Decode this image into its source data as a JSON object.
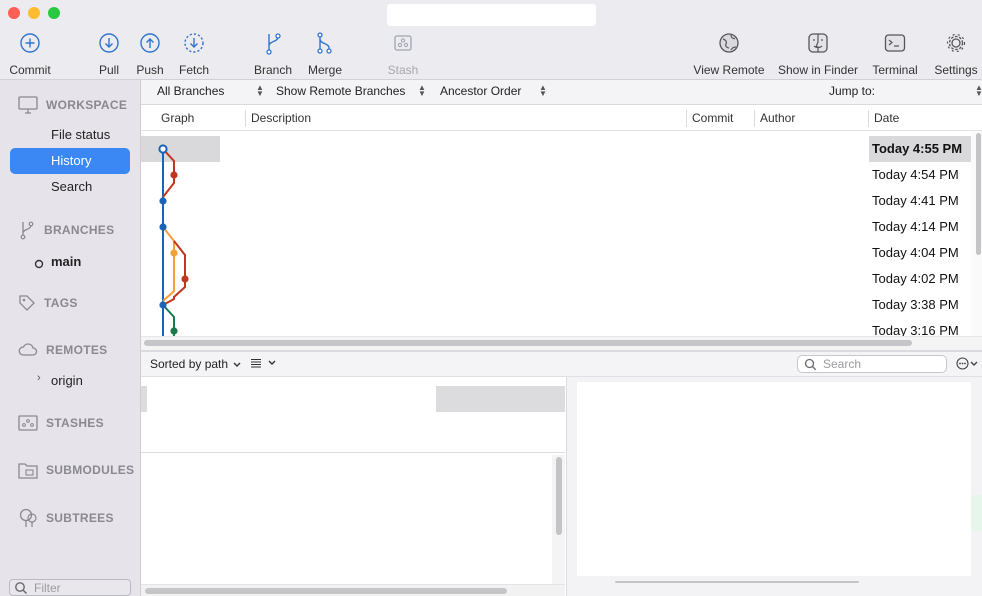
{
  "window": {
    "title": ""
  },
  "toolbar": {
    "commit": "Commit",
    "pull": "Pull",
    "push": "Push",
    "fetch": "Fetch",
    "branch": "Branch",
    "merge": "Merge",
    "stash": "Stash",
    "view_remote": "View Remote",
    "show_in_finder": "Show in Finder",
    "terminal": "Terminal",
    "settings": "Settings"
  },
  "sidebar": {
    "workspace": "WORKSPACE",
    "file_status": "File status",
    "history": "History",
    "search": "Search",
    "branches": "BRANCHES",
    "branch_main": "main",
    "tags": "TAGS",
    "remotes": "REMOTES",
    "remote_origin": "origin",
    "stashes": "STASHES",
    "submodules": "SUBMODULES",
    "subtrees": "SUBTREES",
    "filter_placeholder": "Filter"
  },
  "filterbar": {
    "branches": "All Branches",
    "remote": "Show Remote Branches",
    "order": "Ancestor Order",
    "jump_to": "Jump to:"
  },
  "columns": {
    "graph": "Graph",
    "description": "Description",
    "commit": "Commit",
    "author": "Author",
    "date": "Date"
  },
  "commits": [
    {
      "date": "Today 4:55 PM"
    },
    {
      "date": "Today 4:54 PM"
    },
    {
      "date": "Today 4:41 PM"
    },
    {
      "date": "Today 4:14 PM"
    },
    {
      "date": "Today 4:04 PM"
    },
    {
      "date": "Today 4:02 PM"
    },
    {
      "date": "Today 3:38 PM"
    },
    {
      "date": "Today 3:16 PM"
    }
  ],
  "files": {
    "sort": "Sorted by path",
    "search_placeholder": "Search"
  },
  "colors": {
    "accent": "#3b88f5",
    "lane_blue": "#1b63b5",
    "lane_red": "#c0361f",
    "lane_orange": "#f0a13a",
    "lane_green": "#1a7a49"
  }
}
